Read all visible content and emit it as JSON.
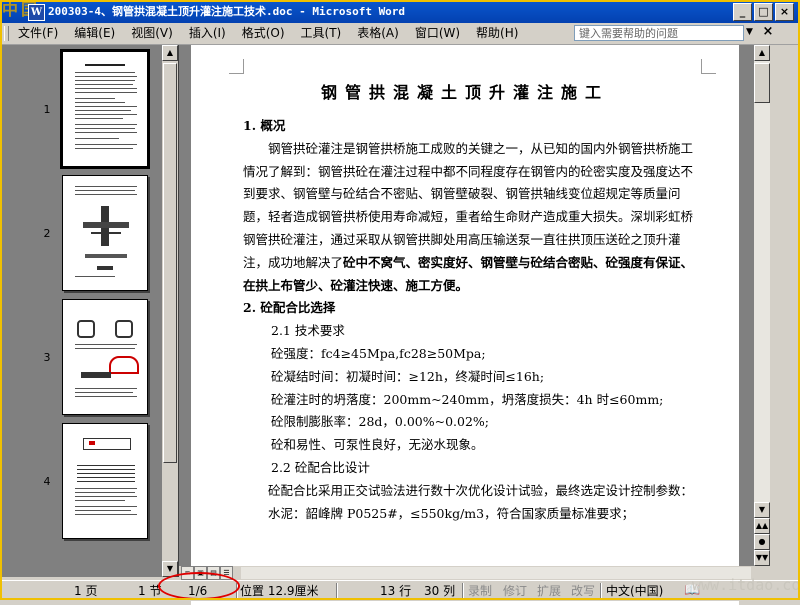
{
  "window": {
    "watermark_logo": "中国",
    "title": "200303-4、钢管拱混凝土顶升灌注施工技术.doc - Microsoft Word",
    "word_icon_letter": "W",
    "minimize": "_",
    "maximize": "□",
    "close": "×"
  },
  "menu": {
    "items": [
      "文件(F)",
      "编辑(E)",
      "视图(V)",
      "插入(I)",
      "格式(O)",
      "工具(T)",
      "表格(A)",
      "窗口(W)",
      "帮助(H)"
    ],
    "help_placeholder": "键入需要帮助的问题",
    "help_dropdown": "▼",
    "doc_close": "×"
  },
  "thumbnails": {
    "pages": [
      {
        "label": "1",
        "selected": true
      },
      {
        "label": "2",
        "selected": false
      },
      {
        "label": "3",
        "selected": false
      },
      {
        "label": "4",
        "selected": false
      }
    ]
  },
  "document": {
    "title": "钢管拱混凝土顶升灌注施工",
    "heading1": "1. 概况",
    "para1": "钢管拱砼灌注是钢管拱桥施工成败的关键之一，从已知的国内外钢管拱桥施工情况了解到：钢管拱砼在灌注过程中都不同程度存在钢管内的砼密实度及强度达不到要求、钢管壁与砼结合不密贴、钢管壁破裂、钢管拱轴线变位超规定等质量问题，轻者造成钢管拱桥使用寿命减短，重者给生命财产造成重大损失。深圳彩虹桥钢管拱砼灌注，通过采取从钢管拱脚处用高压输送泵一直往拱顶压送砼之顶升灌注，成功地解决了",
    "para1_bold": "砼中不窝气、密实度好、钢管壁与砼结合密贴、砼强度有保证、在拱上布管少、砼灌注快速、施工方便。",
    "heading2": "2. 砼配合比选择",
    "sub21": "2.1 技术要求",
    "req1": "砼强度：fc4≥45Mpa,fc28≥50Mpa;",
    "req2": "砼凝结时间：初凝时间：≥12h，终凝时间≤16h;",
    "req3": "砼灌注时的坍落度：200mm~240mm，坍落度损失：4h 时≤60mm;",
    "req4": "砼限制膨胀率：28d，0.00%~0.02%;",
    "req5": "砼和易性、可泵性良好，无泌水现象。",
    "sub22": "2.2 砼配合比设计",
    "para2": "砼配合比采用正交试验法进行数十次优化设计试验，最终选定设计控制参数：",
    "para3": "水泥：韶峰牌 P0525#，≤550kg/m3，符合国家质量标准要求；"
  },
  "statusbar": {
    "page": "1 页",
    "section": "1 节",
    "page_of": "1/6",
    "position": "位置 12.9厘米",
    "line": "13 行",
    "column": "30 列",
    "rec": "录制",
    "trk": "修订",
    "ext": "扩展",
    "ovr": "改写",
    "language": "中文(中国)",
    "site_watermark": "www.itdao.com"
  },
  "colors": {
    "title_bar": "#0a58d0",
    "chrome": "#d4d0c8",
    "annotation": "#e00000"
  }
}
